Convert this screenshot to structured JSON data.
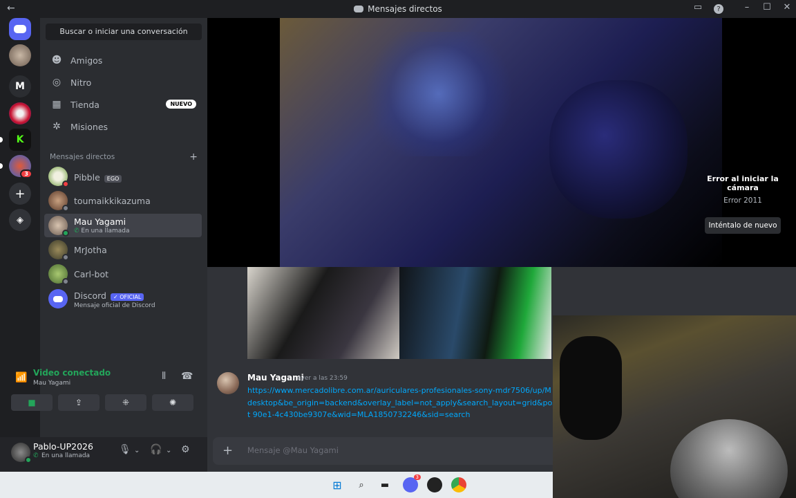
{
  "titlebar": {
    "title": "Mensajes directos",
    "back_icon": "arrow-left-icon",
    "help": "?"
  },
  "sidebar": {
    "search_placeholder": "Buscar o iniciar una conversación",
    "nav": [
      {
        "label": "Amigos",
        "icon": "friends-icon"
      },
      {
        "label": "Nitro",
        "icon": "nitro-icon"
      },
      {
        "label": "Tienda",
        "icon": "shop-icon",
        "badge": "NUEVO"
      },
      {
        "label": "Misiones",
        "icon": "quests-icon"
      }
    ],
    "dm_header": "Mensajes directos",
    "dms": [
      {
        "name": "Pibble",
        "tag": "EGO",
        "status": "#f23f43"
      },
      {
        "name": "toumaikkikazuma",
        "status": "#80848e"
      },
      {
        "name": "Mau Yagami",
        "sub": "En una llamada",
        "status": "#23a55a"
      },
      {
        "name": "MrJotha",
        "status": "#80848e"
      },
      {
        "name": "Carl-bot",
        "status": "#80848e"
      },
      {
        "name": "Discord",
        "tag": "OFICIAL",
        "sub": "Mensaje oficial de Discord"
      }
    ]
  },
  "voice": {
    "status": "Video conectado",
    "channel": "Mau Yagami"
  },
  "user": {
    "name": "Pablo-UP2026",
    "status": "En una llamada"
  },
  "call": {
    "error_title": "Error al iniciar la cámara",
    "error_code": "Error 2011",
    "retry_label": "Inténtalo de nuevo"
  },
  "message": {
    "author": "Mau Yagami",
    "time": "ayer a las 23:59",
    "link": "https://www.mercadolibre.com.ar/auriculares-profesionales-sony-mdr7506/up/M desktop&be_origin=backend&overlay_label=not_apply&search_layout=grid&posit 90e1-4c430be9307e&wid=MLA1850732246&sid=search"
  },
  "composer": {
    "placeholder": "Mensaje @Mau Yagami"
  },
  "servers": {
    "letter": "M",
    "badge_count": "3"
  },
  "taskbar": {
    "discord_badge": "3"
  },
  "colors": {
    "accent": "#5865f2",
    "online": "#23a55a",
    "link": "#00a8fc"
  }
}
